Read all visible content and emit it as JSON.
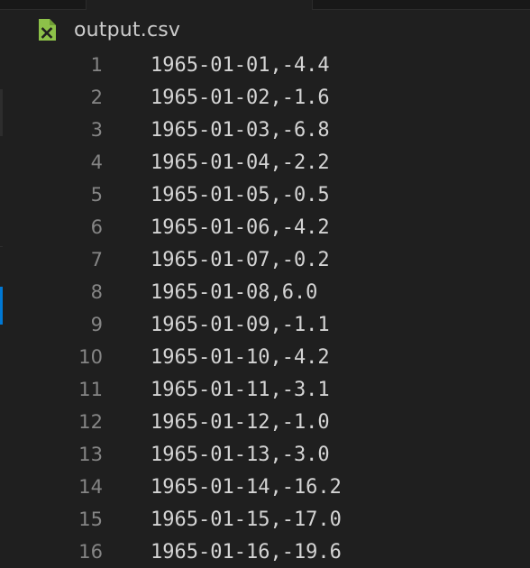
{
  "file": {
    "name": "output.csv",
    "icon": "csv-file-icon",
    "icon_color": "#8dc149"
  },
  "lines": [
    {
      "number": "1",
      "text": "1965-01-01,-4.4"
    },
    {
      "number": "2",
      "text": "1965-01-02,-1.6"
    },
    {
      "number": "3",
      "text": "1965-01-03,-6.8"
    },
    {
      "number": "4",
      "text": "1965-01-04,-2.2"
    },
    {
      "number": "5",
      "text": "1965-01-05,-0.5"
    },
    {
      "number": "6",
      "text": "1965-01-06,-4.2"
    },
    {
      "number": "7",
      "text": "1965-01-07,-0.2"
    },
    {
      "number": "8",
      "text": "1965-01-08,6.0"
    },
    {
      "number": "9",
      "text": "1965-01-09,-1.1"
    },
    {
      "number": "10",
      "text": "1965-01-10,-4.2"
    },
    {
      "number": "11",
      "text": "1965-01-11,-3.1"
    },
    {
      "number": "12",
      "text": "1965-01-12,-1.0"
    },
    {
      "number": "13",
      "text": "1965-01-13,-3.0"
    },
    {
      "number": "14",
      "text": "1965-01-14,-16.2"
    },
    {
      "number": "15",
      "text": "1965-01-15,-17.0"
    },
    {
      "number": "16",
      "text": "1965-01-16,-19.6"
    }
  ],
  "colors": {
    "background": "#1f1f1f",
    "line_number": "#858585",
    "code_text": "#d4d4d4",
    "accent": "#0078d4"
  }
}
